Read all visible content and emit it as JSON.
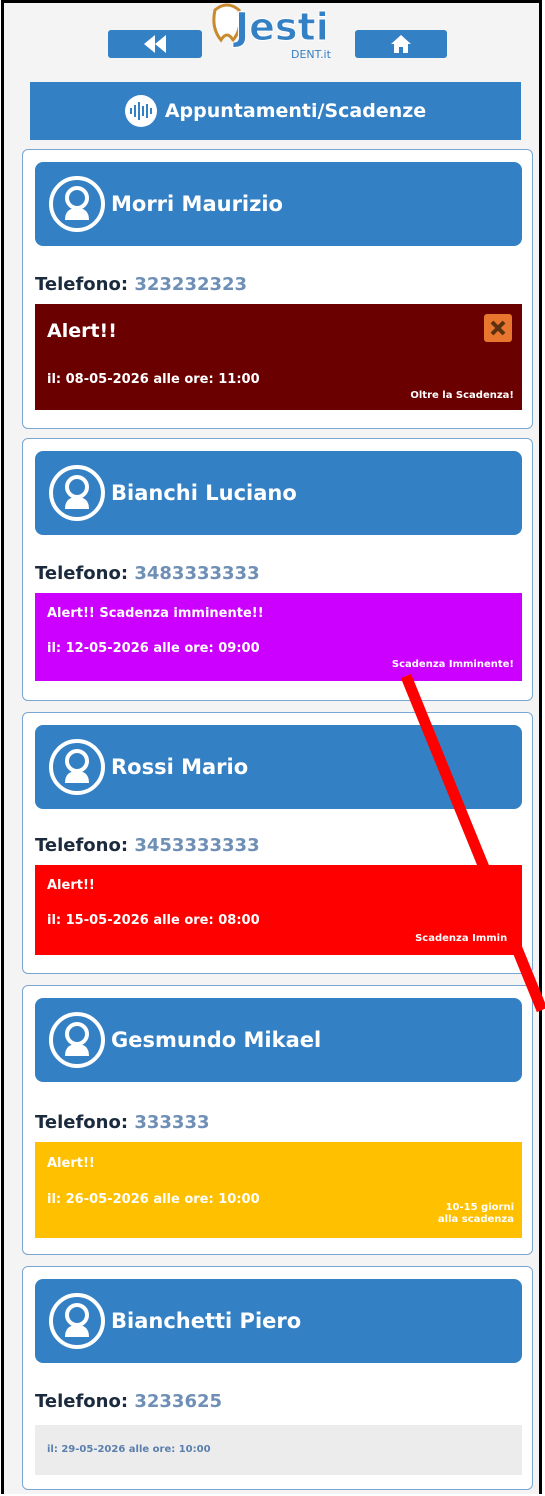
{
  "header": {
    "title": "Appuntamenti/Scadenze",
    "logo_text": "Jesti",
    "logo_sub": "DENT.it"
  },
  "phone_label": "Telefono:",
  "patients": [
    {
      "name": "Morri Maurizio",
      "phone": "323232323",
      "alert_title": "Alert!!",
      "alert_date": "il: 08-05-2026 alle ore: 11:00",
      "alert_status": "Oltre la Scadenza!",
      "alert_color": "#6b0000"
    },
    {
      "name": "Bianchi Luciano",
      "phone": "3483333333",
      "alert_title": "Alert!! Scadenza imminente!!",
      "alert_date": "il: 12-05-2026 alle ore: 09:00",
      "alert_status": "Scadenza Imminente!",
      "alert_color": "#cc00ff"
    },
    {
      "name": "Rossi Mario",
      "phone": "3453333333",
      "alert_title": "Alert!!",
      "alert_date": "il: 15-05-2026 alle ore: 08:00",
      "alert_status": "Scadenza Immine",
      "alert_color": "#ff0000"
    },
    {
      "name": "Gesmundo Mikael",
      "phone": "333333",
      "alert_title": "Alert!!",
      "alert_date": "il: 26-05-2026 alle ore: 10:00",
      "alert_status_line1": "10-15 giorni",
      "alert_status_line2": "alla scadenza",
      "alert_color": "#ffc000"
    },
    {
      "name": "Bianchetti Piero",
      "phone": "3233625",
      "alert_date": "il: 29-05-2026 alle ore: 10:00",
      "alert_color": "#ececec"
    }
  ],
  "colors": {
    "primary": "#3480c4",
    "arrow": "#ff0000"
  }
}
